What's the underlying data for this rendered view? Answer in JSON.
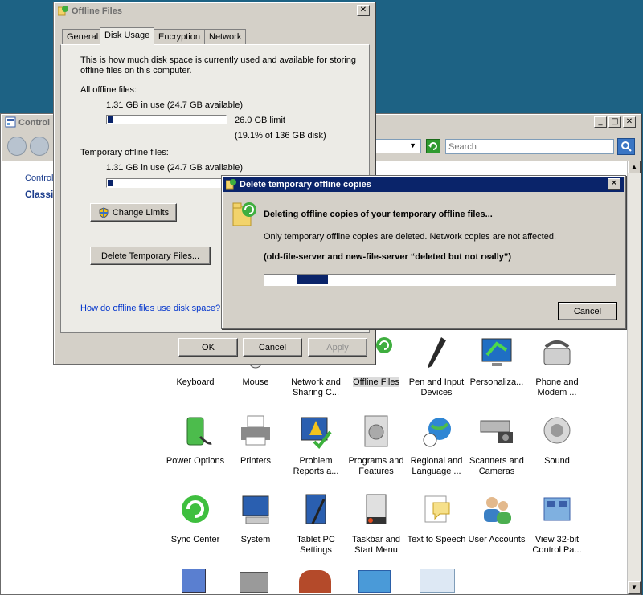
{
  "control_panel": {
    "title": "Control",
    "search_placeholder": "Search",
    "breadcrumb": "Control",
    "view": "Classic",
    "icons_row1": [
      "Keyboard",
      "Mouse",
      "Network and Sharing C...",
      "Offline Files",
      "Pen and Input Devices",
      "Personaliza...",
      "Phone and Modem ..."
    ],
    "icons_row2": [
      "Power Options",
      "Printers",
      "Problem Reports a...",
      "Programs and Features",
      "Regional and Language ...",
      "Scanners and Cameras",
      "Sound"
    ],
    "icons_row3": [
      "Sync Center",
      "System",
      "Tablet PC Settings",
      "Taskbar and Start Menu",
      "Text to Speech",
      "User Accounts",
      "View 32-bit Control Pa..."
    ]
  },
  "offline_files": {
    "title": "Offline Files",
    "tabs": [
      "General",
      "Disk Usage",
      "Encryption",
      "Network"
    ],
    "intro": [
      "This is how much disk space is currently used and available for storing",
      "offline files on this computer."
    ],
    "all_label": "All offline files:",
    "all_usage": "1.31 GB in use (24.7 GB available)",
    "all_fill": 0.05,
    "limit": "26.0 GB limit",
    "limit_pct": "(19.1% of 136 GB disk)",
    "temp_label": "Temporary offline files:",
    "temp_usage": "1.31 GB in use (24.7 GB available)",
    "temp_fill": 0.05,
    "change_limits": "Change Limits",
    "delete_temp": "Delete Temporary Files...",
    "help_link": "How do offline files use disk space?",
    "ok": "OK",
    "cancel": "Cancel",
    "apply": "Apply"
  },
  "delete_dialog": {
    "title": "Delete temporary offline copies",
    "heading": "Deleting offline copies of your temporary offline files...",
    "info": "Only temporary offline copies are deleted.  Network copies are not affected.",
    "servers": "(old-file-server and new-file-server “deleted but not really”)",
    "progress_start": 0.09,
    "progress_width": 0.09,
    "cancel": "Cancel"
  }
}
